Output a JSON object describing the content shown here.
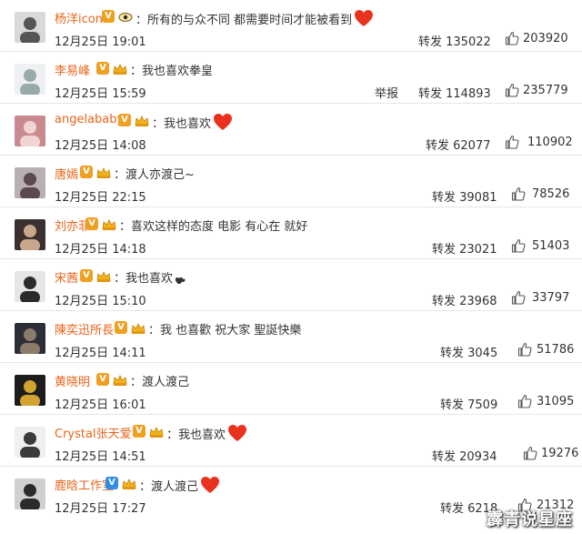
{
  "watermark": "霹青说星座",
  "accent_orange": "#e8641b",
  "comments": [
    {
      "user": "杨洋icon",
      "badge": "V",
      "badge_color": "#f0a020",
      "crown": "eye",
      "text": "：所有的与众不同 都需要时间才能被看到",
      "emoji": "heart",
      "date": "12月25日 19:01",
      "report": "",
      "repost": "转发 135022",
      "likes": "203920"
    },
    {
      "user": "李易峰",
      "badge": "V",
      "badge_color": "#f0a020",
      "crown": "crown",
      "text": "：我也喜欢拳皇",
      "emoji": "",
      "date": "12月25日 15:59",
      "report": "举报",
      "repost": "转发 114893",
      "likes": "235779"
    },
    {
      "user": "angelababy",
      "badge": "V",
      "badge_color": "#f0a020",
      "crown": "crown",
      "text": "：我也喜欢",
      "emoji": "heart",
      "date": "12月25日 14:08",
      "report": "",
      "repost": "转发 62077",
      "likes": "110902"
    },
    {
      "user": "唐嫣",
      "badge": "V",
      "badge_color": "#f0a020",
      "crown": "crown",
      "text": "：渡人亦渡己~",
      "emoji": "",
      "date": "12月25日 22:15",
      "report": "",
      "repost": "转发 39081",
      "likes": "78526"
    },
    {
      "user": "刘亦菲",
      "badge": "V",
      "badge_color": "#f0a020",
      "crown": "crown",
      "text": "：喜欢这样的态度 电影 有心在 就好",
      "emoji": "",
      "date": "12月25日 14:18",
      "report": "",
      "repost": "转发 23021",
      "likes": "51403"
    },
    {
      "user": "宋茜",
      "badge": "V",
      "badge_color": "#f0a020",
      "crown": "crown",
      "text": "：我也喜欢",
      "emoji": "hearts-small",
      "date": "12月25日 15:10",
      "report": "",
      "repost": "转发 23968",
      "likes": "33797"
    },
    {
      "user": "陳奕迅所長",
      "badge": "V",
      "badge_color": "#f0a020",
      "crown": "crown",
      "text": "：我 也喜歡 祝大家 聖誕快樂",
      "emoji": "",
      "date": "12月25日 14:11",
      "report": "",
      "repost": "转发 3045",
      "likes": "51786"
    },
    {
      "user": "黄晓明",
      "badge": "V",
      "badge_color": "#f0a020",
      "crown": "crown",
      "text": "：渡人渡己",
      "emoji": "",
      "date": "12月25日 16:01",
      "report": "",
      "repost": "转发 7509",
      "likes": "31095"
    },
    {
      "user": "Crystal张天爱",
      "badge": "V",
      "badge_color": "#f0a020",
      "crown": "crown",
      "text": "：我也喜欢",
      "emoji": "heart",
      "date": "12月25日 14:51",
      "report": "",
      "repost": "转发 20934",
      "likes": "19276"
    },
    {
      "user": "鹿晗工作室",
      "badge": "V",
      "badge_color": "#2e8de4",
      "crown": "crown",
      "text": "：渡人渡己",
      "emoji": "heart",
      "date": "12月25日 17:27",
      "report": "",
      "repost": "转发 6218",
      "likes": "21312"
    }
  ]
}
